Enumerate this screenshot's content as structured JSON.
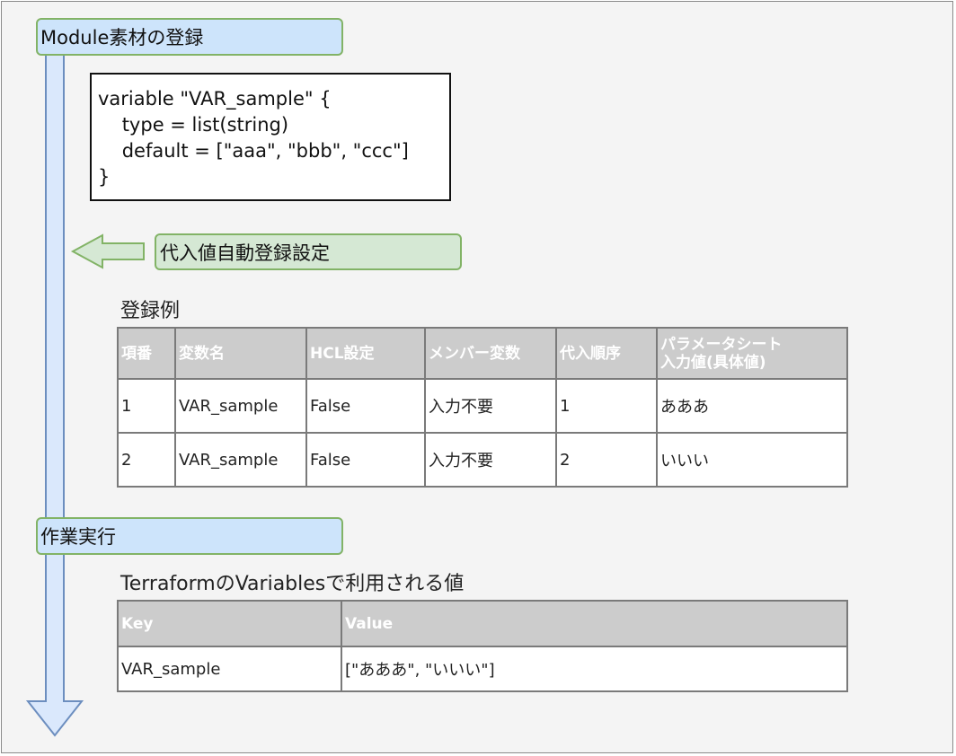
{
  "steps": [
    {
      "label": "Module素材の登録"
    },
    {
      "label": "作業実行"
    }
  ],
  "code_block": {
    "lines": [
      "variable \"VAR_sample\" {",
      "    type = list(string)",
      "    default = [\"aaa\", \"bbb\", \"ccc\"]",
      "}"
    ]
  },
  "setting_label": "代入値自動登録設定",
  "example": {
    "caption": "登録例",
    "headers": [
      "項番",
      "変数名",
      "HCL設定",
      "メンバー変数",
      "代入順序",
      "パラメータシート\n入力値(具体値)"
    ],
    "rows": [
      [
        "1",
        "VAR_sample",
        "False",
        "入力不要",
        "1",
        "あああ"
      ],
      [
        "2",
        "VAR_sample",
        "False",
        "入力不要",
        "2",
        "いいい"
      ]
    ]
  },
  "result": {
    "caption": "TerraformのVariablesで利用される値",
    "headers": [
      "Key",
      "Value"
    ],
    "rows": [
      [
        "VAR_sample",
        "[\"あああ\", \"いいい\"]"
      ]
    ]
  },
  "colors": {
    "step_fill": "#cde4fb",
    "step_border": "#82b366",
    "setting_fill": "#d5e8d4",
    "arrow_fill": "#dae8fc",
    "arrow_stroke": "#6c8ebf",
    "header_fill": "#cccccc"
  }
}
